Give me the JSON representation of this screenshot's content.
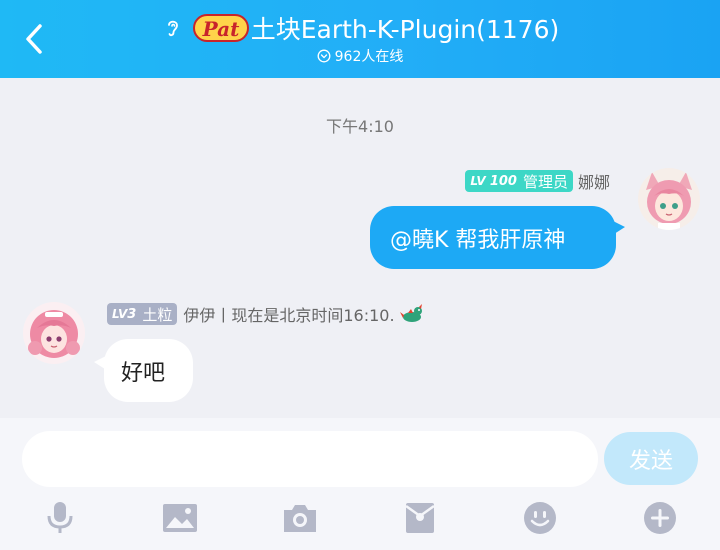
{
  "header": {
    "logo_text": "Pat",
    "title": "土块Earth-K-Plugin(1176)",
    "online_count": "962人在线"
  },
  "chat": {
    "timestamp": "下午4:10",
    "messages": [
      {
        "side": "right",
        "level_prefix": "LV",
        "level_num": "100",
        "role": "管理员",
        "name": "娜娜",
        "text": "@曉K 帮我肝原神"
      },
      {
        "side": "left",
        "level_prefix": "LV",
        "level_num": "3",
        "role": "土粒",
        "name": "伊伊丨现在是北京时间16:10.",
        "text": "好吧"
      }
    ]
  },
  "input": {
    "placeholder": "",
    "value": "",
    "send_label": "发送"
  },
  "toolbar": {
    "icons": [
      "microphone-icon",
      "image-icon",
      "camera-icon",
      "red-packet-icon",
      "emoji-icon",
      "plus-icon"
    ]
  },
  "colors": {
    "header": "#1fb9f5",
    "bubble_self": "#1da9f5",
    "admin_badge": "#3dd7c6",
    "member_badge": "#a9b0c6",
    "send_disabled": "#c2e8fb",
    "toolbar_icon": "#b4b8c8"
  }
}
